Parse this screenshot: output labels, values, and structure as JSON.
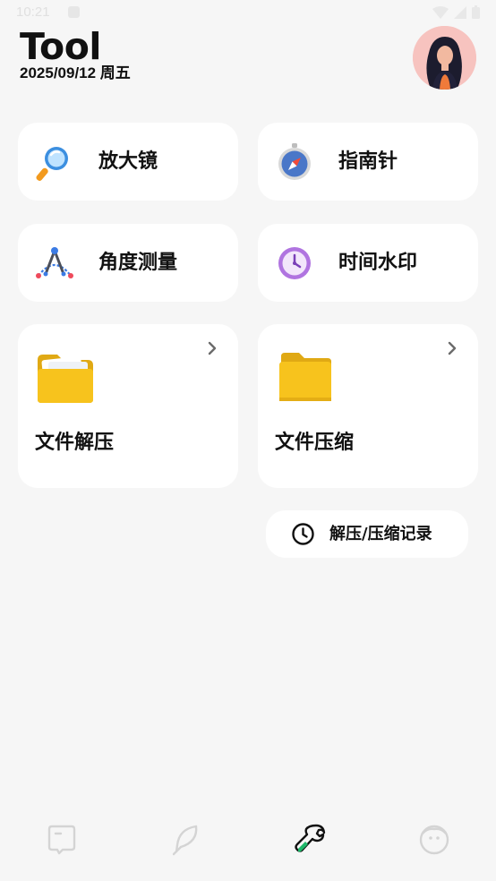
{
  "status_bar": {
    "time": "10:21"
  },
  "header": {
    "title": "Tool",
    "date": "2025/09/12 周五"
  },
  "tools": {
    "magnifier": "放大镜",
    "compass": "指南针",
    "angle": "角度测量",
    "watermark": "时间水印",
    "decompress": "文件解压",
    "compress": "文件压缩"
  },
  "history": {
    "label": "解压/压缩记录"
  },
  "bottom_nav": {
    "items": [
      {
        "icon": "chat-bubble-icon",
        "active": false
      },
      {
        "icon": "feather-icon",
        "active": false
      },
      {
        "icon": "wrench-icon",
        "active": true
      },
      {
        "icon": "face-icon",
        "active": false
      }
    ]
  },
  "colors": {
    "accent": "#1fb86a",
    "background": "#f6f6f6",
    "card": "#ffffff",
    "folder": "#f5c21b"
  }
}
